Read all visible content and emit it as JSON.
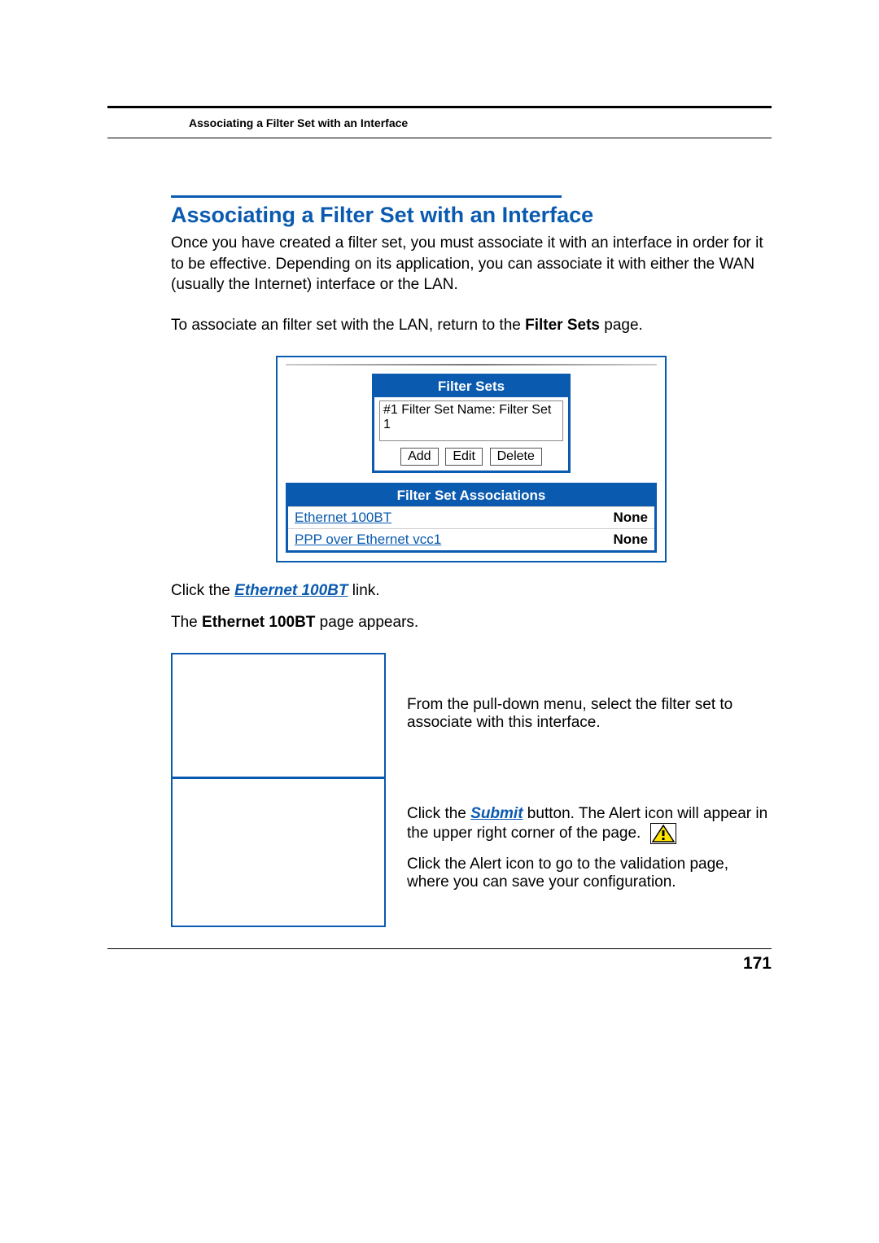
{
  "running_head": "Associating a Filter Set with an Interface",
  "title": "Associating a Filter Set with an Interface",
  "para1": "Once you have created a filter set, you must associate it with an interface in order for it to be effective. Depending on its application, you can associate it with either the WAN (usually the Internet) interface or the LAN.",
  "para2_pre": "To associate an filter set with the LAN, return to the ",
  "para2_bold": "Filter Sets",
  "para2_post": " page.",
  "filter_sets": {
    "header": "Filter Sets",
    "item": "#1 Filter Set Name: Filter Set 1",
    "buttons": {
      "add": "Add",
      "edit": "Edit",
      "delete": "Delete"
    }
  },
  "associations": {
    "header": "Filter Set Associations",
    "rows": [
      {
        "name": "Ethernet 100BT",
        "value": "None"
      },
      {
        "name": "PPP over Ethernet vcc1",
        "value": "None"
      }
    ]
  },
  "click_line_pre": "Click the ",
  "click_line_link": "Ethernet 100BT",
  "click_line_post": " link.",
  "appears_pre": "The ",
  "appears_bold": "Ethernet 100BT",
  "appears_post": " page appears.",
  "step1": "From the pull-down menu, select the filter set to associate with this interface.",
  "step2_pre": "Click the ",
  "step2_link": "Submit",
  "step2_mid": " button. The Alert icon will appear in the upper right corner of the page.",
  "step3": "Click the Alert icon to go to the validation page, where you can save your configuration.",
  "page_number": "171"
}
